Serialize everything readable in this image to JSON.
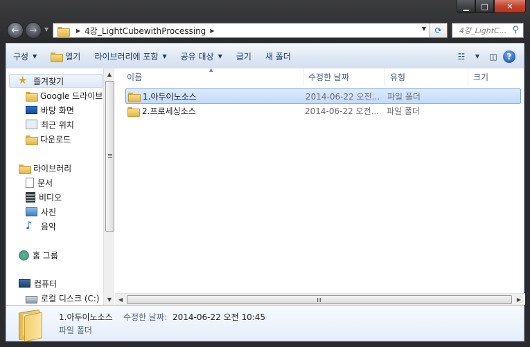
{
  "window": {
    "minimize_glyph": "▁",
    "maximize_glyph": "□",
    "close_glyph": "✕"
  },
  "nav": {
    "back_glyph": "←",
    "forward_glyph": "→",
    "breadcrumb": "4강_LightCubewithProcessing",
    "search_placeholder": "4강_LightC..."
  },
  "toolbar": {
    "organize": "구성",
    "open": "열기",
    "include_in_library": "라이브러리에 포함",
    "share_with": "공유 대상",
    "burn": "굽기",
    "new_folder": "새 폴더"
  },
  "sidebar": {
    "favorites": "즐겨찾기",
    "favorites_items": [
      "Google 드라이브",
      "바탕 화면",
      "최근 위치",
      "다운로드"
    ],
    "libraries": "라이브러리",
    "libraries_items": [
      "문서",
      "비디오",
      "사진",
      "음악"
    ],
    "homegroup": "홈 그룹",
    "computer": "컴퓨터",
    "computer_items": [
      "로컬 디스크 (C:)"
    ]
  },
  "columns": {
    "name": "이름",
    "date_modified": "수정한 날짜",
    "type": "유형",
    "size": "크기"
  },
  "files": [
    {
      "name": "1.아두이노소스",
      "date": "2014-06-22 오전...",
      "type": "파일 폴더",
      "selected": true
    },
    {
      "name": "2.프로세싱소스",
      "date": "2014-06-22 오전...",
      "type": "파일 폴더",
      "selected": false
    }
  ],
  "details": {
    "name": "1.아두이노소스",
    "modified_label": "수정한 날짜:",
    "modified_value": "2014-06-22 오전 10:45",
    "type": "파일 폴더"
  },
  "colors": {
    "selection": "#c1dbfc",
    "toolbar_text": "#1e395b",
    "folder": "#e4b74c"
  }
}
